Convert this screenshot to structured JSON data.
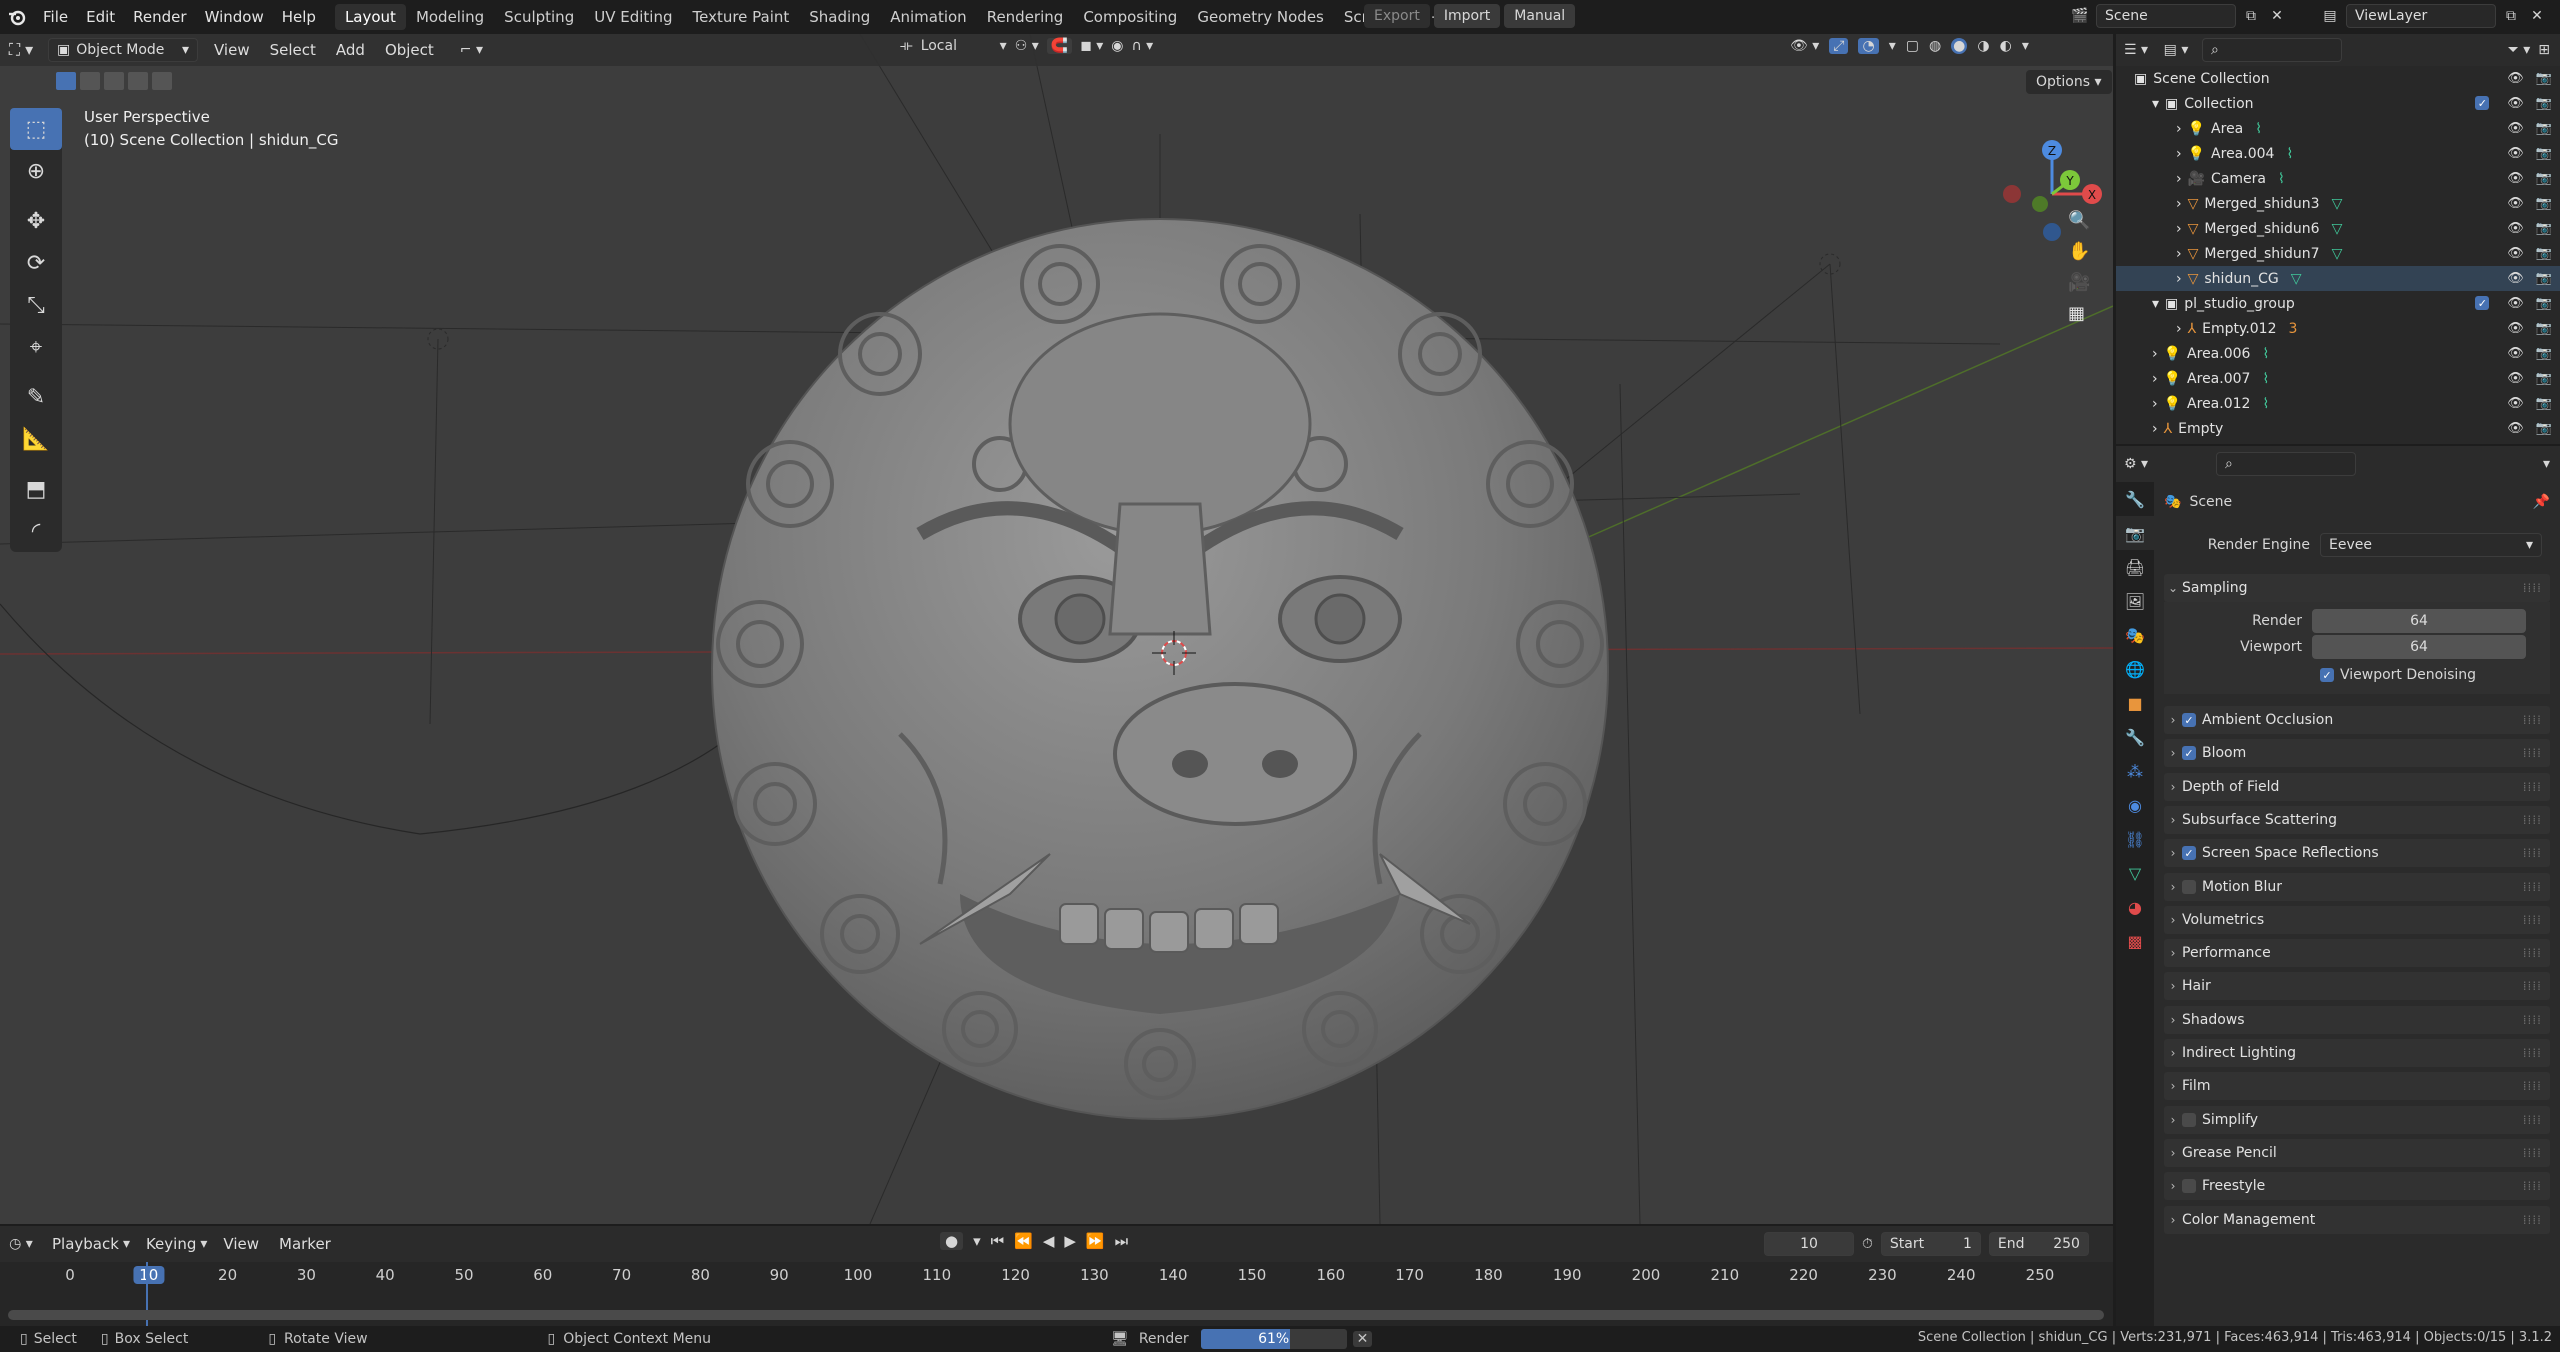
{
  "topbar": {
    "menus": [
      "File",
      "Edit",
      "Render",
      "Window",
      "Help"
    ],
    "workspaces": [
      "Layout",
      "Modeling",
      "Sculpting",
      "UV Editing",
      "Texture Paint",
      "Shading",
      "Animation",
      "Rendering",
      "Compositing",
      "Geometry Nodes",
      "Scripting"
    ],
    "active_workspace": "Layout",
    "add_tab": "+",
    "export": "Export",
    "import": "Import",
    "manual": "Manual",
    "scene": "Scene",
    "view_layer": "ViewLayer"
  },
  "viewport": {
    "mode": "Object Mode",
    "menus": [
      "View",
      "Select",
      "Add",
      "Object"
    ],
    "transform_orientation": "Local",
    "options": "Options",
    "info_line1": "User Perspective",
    "info_line2": "(10) Scene Collection | shidun_CG",
    "gizmo": {
      "z": "Z",
      "y": "Y",
      "x": "X"
    }
  },
  "outliner": {
    "rows": [
      {
        "label": "Scene Collection",
        "indent": 0,
        "icon": "collection"
      },
      {
        "label": "Collection",
        "indent": 1,
        "icon": "collection"
      },
      {
        "label": "Area",
        "indent": 2,
        "icon": "light"
      },
      {
        "label": "Area.004",
        "indent": 2,
        "icon": "light"
      },
      {
        "label": "Camera",
        "indent": 2,
        "icon": "camera"
      },
      {
        "label": "Merged_shidun3",
        "indent": 2,
        "icon": "mesh"
      },
      {
        "label": "Merged_shidun6",
        "indent": 2,
        "icon": "mesh"
      },
      {
        "label": "Merged_shidun7",
        "indent": 2,
        "icon": "mesh"
      },
      {
        "label": "shidun_CG",
        "indent": 2,
        "icon": "mesh"
      },
      {
        "label": "pl_studio_group",
        "indent": 1,
        "icon": "collection"
      },
      {
        "label": "Empty.012",
        "indent": 2,
        "icon": "empty"
      },
      {
        "label": "Area.006",
        "indent": 1,
        "icon": "light"
      },
      {
        "label": "Area.007",
        "indent": 1,
        "icon": "light"
      },
      {
        "label": "Area.012",
        "indent": 1,
        "icon": "light"
      },
      {
        "label": "Empty",
        "indent": 1,
        "icon": "empty"
      }
    ],
    "empty_child_count": "3"
  },
  "properties": {
    "context": "Scene",
    "render_engine_label": "Render Engine",
    "render_engine": "Eevee",
    "sampling": {
      "title": "Sampling",
      "render_label": "Render",
      "render_value": "64",
      "viewport_label": "Viewport",
      "viewport_value": "64",
      "denoise_label": "Viewport Denoising"
    },
    "panels": [
      {
        "label": "Ambient Occlusion",
        "checkbox": true,
        "checked": true
      },
      {
        "label": "Bloom",
        "checkbox": true,
        "checked": true
      },
      {
        "label": "Depth of Field",
        "checkbox": false
      },
      {
        "label": "Subsurface Scattering",
        "checkbox": false
      },
      {
        "label": "Screen Space Reflections",
        "checkbox": true,
        "checked": true
      },
      {
        "label": "Motion Blur",
        "checkbox": true,
        "checked": false
      },
      {
        "label": "Volumetrics",
        "checkbox": false
      },
      {
        "label": "Performance",
        "checkbox": false
      },
      {
        "label": "Hair",
        "checkbox": false
      },
      {
        "label": "Shadows",
        "checkbox": false
      },
      {
        "label": "Indirect Lighting",
        "checkbox": false
      },
      {
        "label": "Film",
        "checkbox": false
      },
      {
        "label": "Simplify",
        "checkbox": true,
        "checked": false
      },
      {
        "label": "Grease Pencil",
        "checkbox": false
      },
      {
        "label": "Freestyle",
        "checkbox": true,
        "checked": false
      },
      {
        "label": "Color Management",
        "checkbox": false
      }
    ]
  },
  "timeline": {
    "menus": [
      "Playback",
      "Keying",
      "View",
      "Marker"
    ],
    "current_frame": "10",
    "start_label": "Start",
    "start": "1",
    "end_label": "End",
    "end": "250",
    "ticks": [
      "0",
      "10",
      "20",
      "30",
      "40",
      "50",
      "60",
      "70",
      "80",
      "90",
      "100",
      "110",
      "120",
      "130",
      "140",
      "150",
      "160",
      "170",
      "180",
      "190",
      "200",
      "210",
      "220",
      "230",
      "240",
      "250"
    ]
  },
  "statusbar": {
    "select": "Select",
    "box_select": "Box Select",
    "rotate_view": "Rotate View",
    "context_menu": "Object Context Menu",
    "render_label": "Render",
    "render_progress": 0.61,
    "render_progress_text": "61%",
    "stats": "Scene Collection | shidun_CG | Verts:231,971 | Faces:463,914 | Tris:463,914 | Objects:0/15 | 3.1.2"
  },
  "colors": {
    "accent": "#4772b3",
    "light_icon": "#e8953c",
    "mesh_icon": "#e8953c",
    "data_icon": "#41c89a",
    "x_axis": "#e04b4b",
    "y_axis": "#7cc83a",
    "z_axis": "#4d8be0"
  }
}
